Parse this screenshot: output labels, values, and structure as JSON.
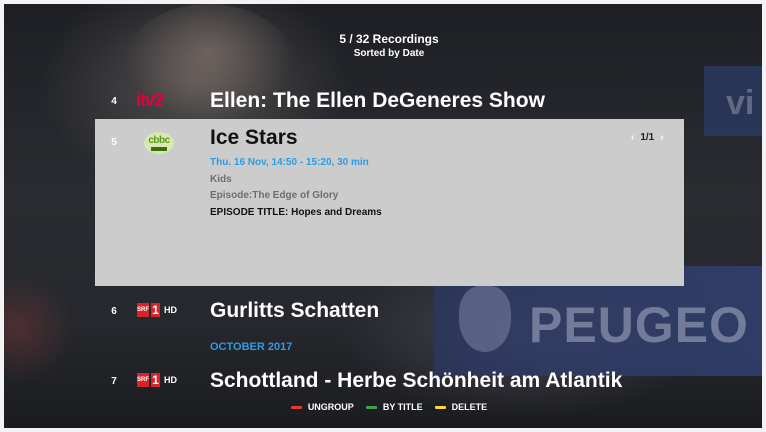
{
  "header": {
    "count": "5 / 32 Recordings",
    "sort": "Sorted by Date"
  },
  "recordings": [
    {
      "number": "4",
      "channel": "itv2",
      "channel_logo_text": "itv2",
      "title": "Ellen: The Ellen DeGeneres Show"
    },
    {
      "number": "5",
      "channel": "cbbc",
      "channel_logo_text": "cbbc",
      "title": "Ice Stars",
      "time": "Thu. 16 Nov, 14:50 - 15:20, 30 min",
      "genre": "Kids",
      "episode": "Episode:The Edge of Glory",
      "episode_title": "EPISODE TITLE: Hopes and Dreams",
      "page": "1/1"
    },
    {
      "number": "6",
      "channel": "srf1-hd",
      "channel_logo_text": [
        "SRF",
        "1",
        "HD"
      ],
      "title": "Gurlitts Schatten"
    },
    {
      "number": "7",
      "channel": "srf1-hd",
      "channel_logo_text": [
        "SRF",
        "1",
        "HD"
      ],
      "title": "Schottland - Herbe Schönheit am Atlantik"
    }
  ],
  "section_header": "OCTOBER 2017",
  "footer": {
    "hints": [
      {
        "color": "#e53935",
        "label": "UNGROUP"
      },
      {
        "color": "#43a047",
        "label": "BY TITLE"
      },
      {
        "color": "#fdd835",
        "label": "DELETE"
      }
    ]
  },
  "background_text": {
    "left_banner": "vi",
    "right_banner": "PEUGEO"
  },
  "colors": {
    "accent_blue": "#2e9be6",
    "selected_bg": "#cccccc",
    "itv_red": "#e4003b",
    "srf_red": "#d8232a"
  }
}
